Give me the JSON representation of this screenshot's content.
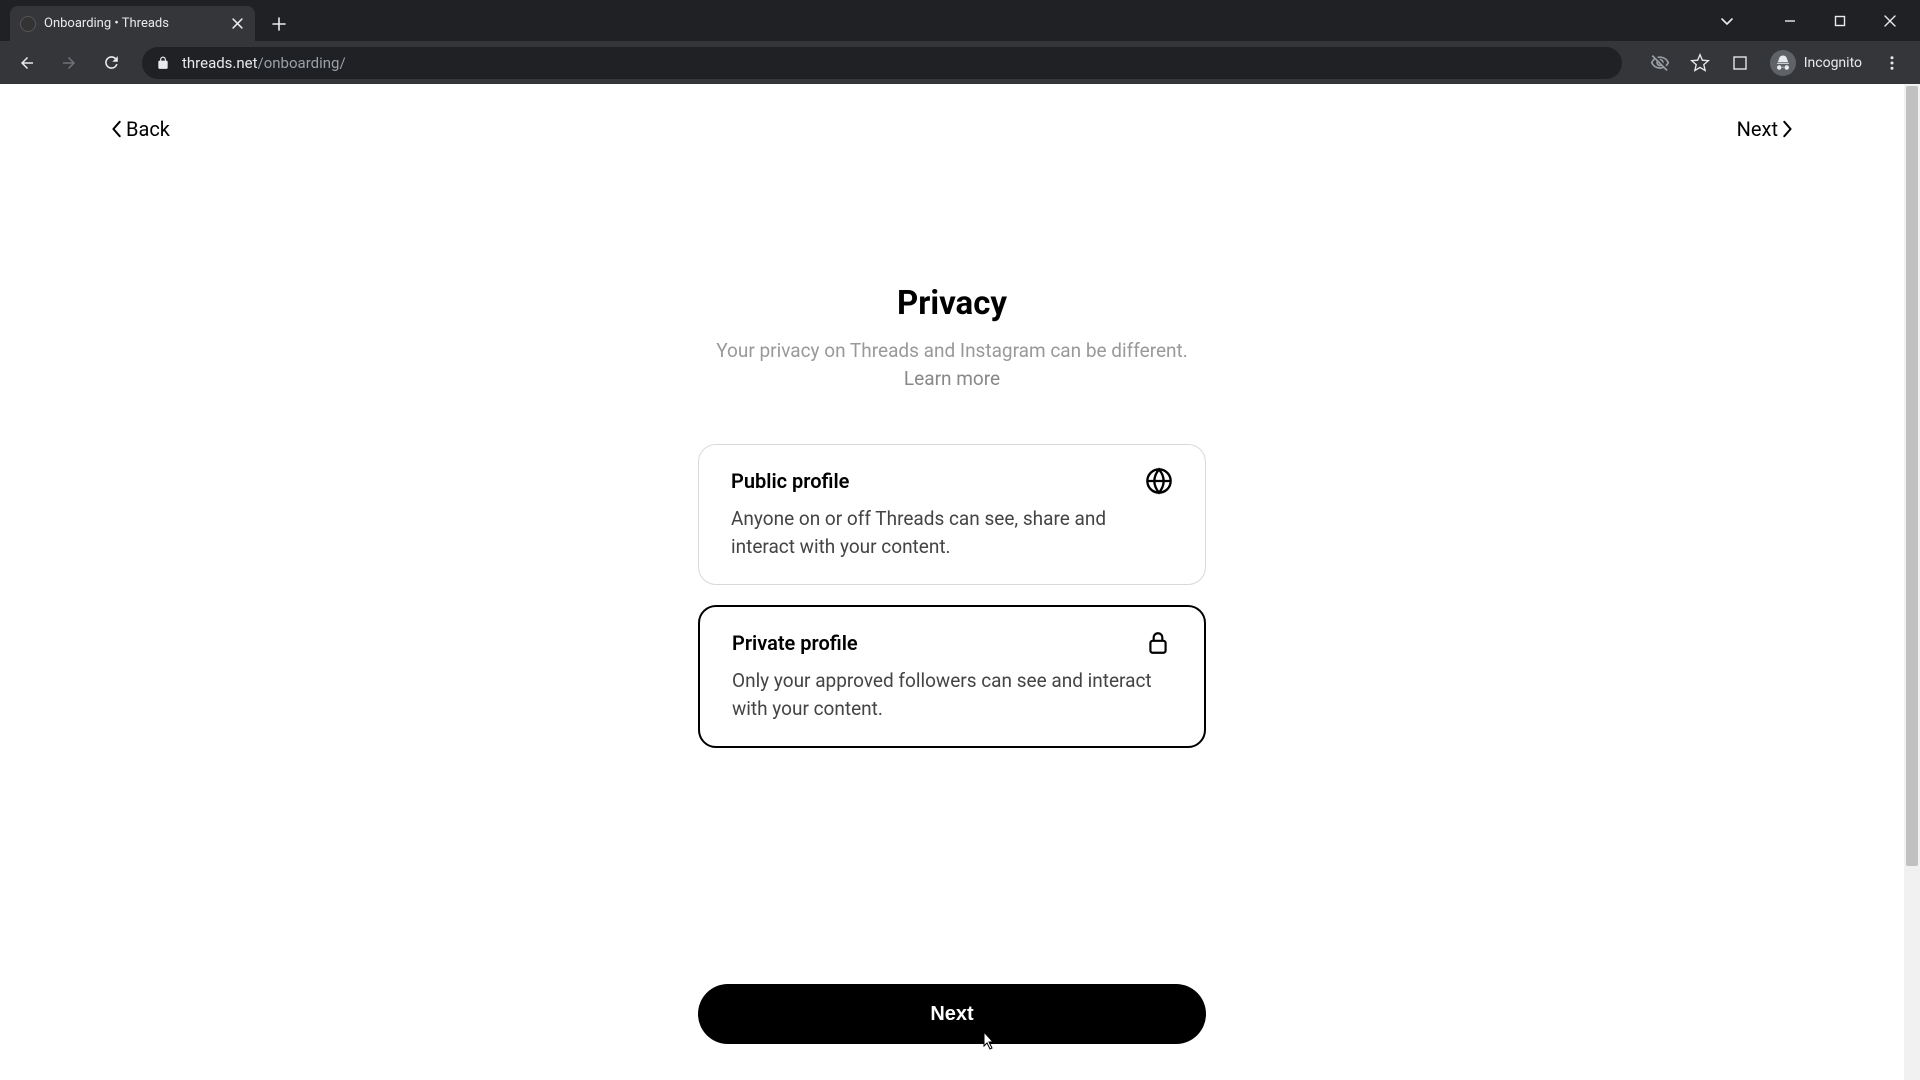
{
  "browser": {
    "tab_title": "Onboarding • Threads",
    "url_domain": "threads.net",
    "url_path": "/onboarding/",
    "incognito_label": "Incognito"
  },
  "topnav": {
    "back_label": "Back",
    "next_label": "Next"
  },
  "page": {
    "heading": "Privacy",
    "subtitle_line1": "Your privacy on Threads and Instagram can be different.",
    "learn_more": "Learn more"
  },
  "options": {
    "public": {
      "title": "Public profile",
      "desc": "Anyone on or off Threads can see, share and interact with your content."
    },
    "private": {
      "title": "Private profile",
      "desc": "Only your approved followers can see and interact with your content."
    }
  },
  "cta": {
    "next": "Next"
  }
}
